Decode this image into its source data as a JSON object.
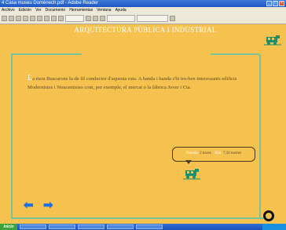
{
  "window": {
    "title": "4 Casa museu Domènech.pdf - Adobe Reader"
  },
  "menu": [
    "Archivo",
    "Edición",
    "Ver",
    "Documento",
    "Herramientas",
    "Ventana",
    "Ayuda"
  ],
  "page": {
    "title": "ARQUITECTURA PÚBLICA I INDUSTRIAL",
    "dropcap": "L",
    "paragraph": "a riera Buscarons fa de fil conductor d'aquesta ruta. A banda i banda s'hi tro-ben interessants edificis Modernistes i Noucentistes com, per exemple, el mercat o la fàbrica Jover i Cia.",
    "duration_label": "Durada:",
    "duration_value": "2 hores",
    "length_label": "Km:",
    "length_value": "7,30 metres"
  },
  "nav": {
    "prev": "⬅",
    "next": "➡"
  },
  "colors": {
    "background": "#f6c24f",
    "lines": "#7bc29a",
    "arrows": "#1a6ee8"
  },
  "icons": [
    "tram-icon",
    "back-arrow-icon",
    "forward-arrow-icon",
    "ring-icon"
  ],
  "taskbar": {
    "start": "Inicio"
  }
}
